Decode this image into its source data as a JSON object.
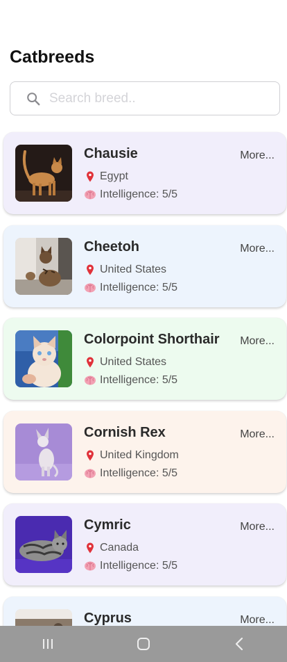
{
  "app": {
    "title": "Catbreeds"
  },
  "search": {
    "placeholder": "Search breed.."
  },
  "labels": {
    "more": "More..."
  },
  "breeds": [
    {
      "name": "Chausie",
      "origin": "Egypt",
      "intelligence": "Intelligence: 5/5",
      "card_color": "#f1eefb"
    },
    {
      "name": "Cheetoh",
      "origin": "United States",
      "intelligence": "Intelligence: 5/5",
      "card_color": "#edf4fd"
    },
    {
      "name": "Colorpoint Shorthair",
      "origin": "United States",
      "intelligence": "Intelligence: 5/5",
      "card_color": "#edfbef"
    },
    {
      "name": "Cornish Rex",
      "origin": "United Kingdom",
      "intelligence": "Intelligence: 5/5",
      "card_color": "#fdf3ec"
    },
    {
      "name": "Cymric",
      "origin": "Canada",
      "intelligence": "Intelligence: 5/5",
      "card_color": "#f1eefb"
    },
    {
      "name": "Cyprus",
      "origin": "",
      "intelligence": "",
      "card_color": "#edf4fd"
    }
  ],
  "icons": {
    "search": "search-icon",
    "origin": "pin-icon",
    "intelligence": "brain-icon"
  },
  "navbar": {
    "items": [
      "recent-apps-icon",
      "home-icon",
      "back-icon"
    ]
  }
}
